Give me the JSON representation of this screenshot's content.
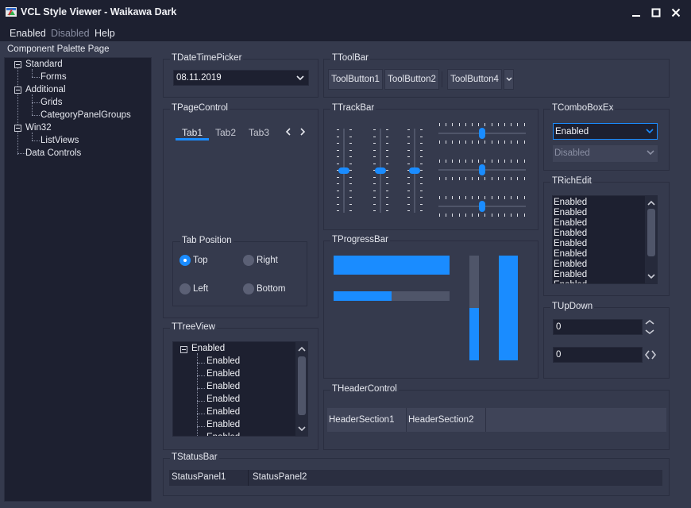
{
  "window": {
    "title": "VCL Style Viewer - Waikawa Dark"
  },
  "menu": [
    {
      "label": "Enabled"
    },
    {
      "label": "Disabled"
    },
    {
      "label": "Help"
    }
  ],
  "palette": {
    "title": "Component Palette Page",
    "tree": [
      {
        "label": "Standard"
      },
      {
        "label": "Forms"
      },
      {
        "label": "Additional"
      },
      {
        "label": "Grids"
      },
      {
        "label": "CategoryPanelGroups"
      },
      {
        "label": "Win32"
      },
      {
        "label": "ListViews"
      },
      {
        "label": "Data Controls"
      }
    ]
  },
  "datetimepicker": {
    "title": "TDateTimePicker",
    "value": "08.11.2019"
  },
  "toolbar": {
    "title": "TToolBar",
    "buttons": [
      "ToolButton1",
      "ToolButton2",
      "ToolButton4"
    ]
  },
  "pagecontrol": {
    "title": "TPageControl",
    "tabs": [
      "Tab1",
      "Tab2",
      "Tab3"
    ],
    "tab_position": {
      "title": "Tab Position",
      "options": [
        "Top",
        "Right",
        "Left",
        "Bottom"
      ],
      "selected": "Top"
    }
  },
  "trackbar": {
    "title": "TTrackBar"
  },
  "comboboxex": {
    "title": "TComboBoxEx",
    "enabled_value": "Enabled",
    "disabled_value": "Disabled"
  },
  "richedit": {
    "title": "TRichEdit",
    "lines": [
      "Enabled",
      "Enabled",
      "Enabled",
      "Enabled",
      "Enabled",
      "Enabled",
      "Enabled",
      "Enabled",
      "Enabled"
    ]
  },
  "progressbar": {
    "title": "TProgressBar",
    "horizontal_1": 1.0,
    "horizontal_2": 0.5,
    "vertical_1": 0.5,
    "vertical_2": 1.0
  },
  "updown": {
    "title": "TUpDown",
    "value_1": "0",
    "value_2": "0"
  },
  "treeview": {
    "title": "TTreeView",
    "root": "Enabled",
    "children": [
      "Enabled",
      "Enabled",
      "Enabled",
      "Enabled",
      "Enabled",
      "Enabled",
      "Enabled"
    ]
  },
  "headercontrol": {
    "title": "THeaderControl",
    "sections": [
      "HeaderSection1",
      "HeaderSection2"
    ]
  },
  "statusbar": {
    "title": "TStatusBar",
    "panels": [
      "StatusPanel1",
      "StatusPanel2"
    ]
  },
  "colors": {
    "accent": "#1a8cff",
    "window_bg": "#353a4d",
    "field_bg": "#1d2030",
    "text": "#e6e8ef",
    "disabled_text": "#8a8fa3"
  }
}
